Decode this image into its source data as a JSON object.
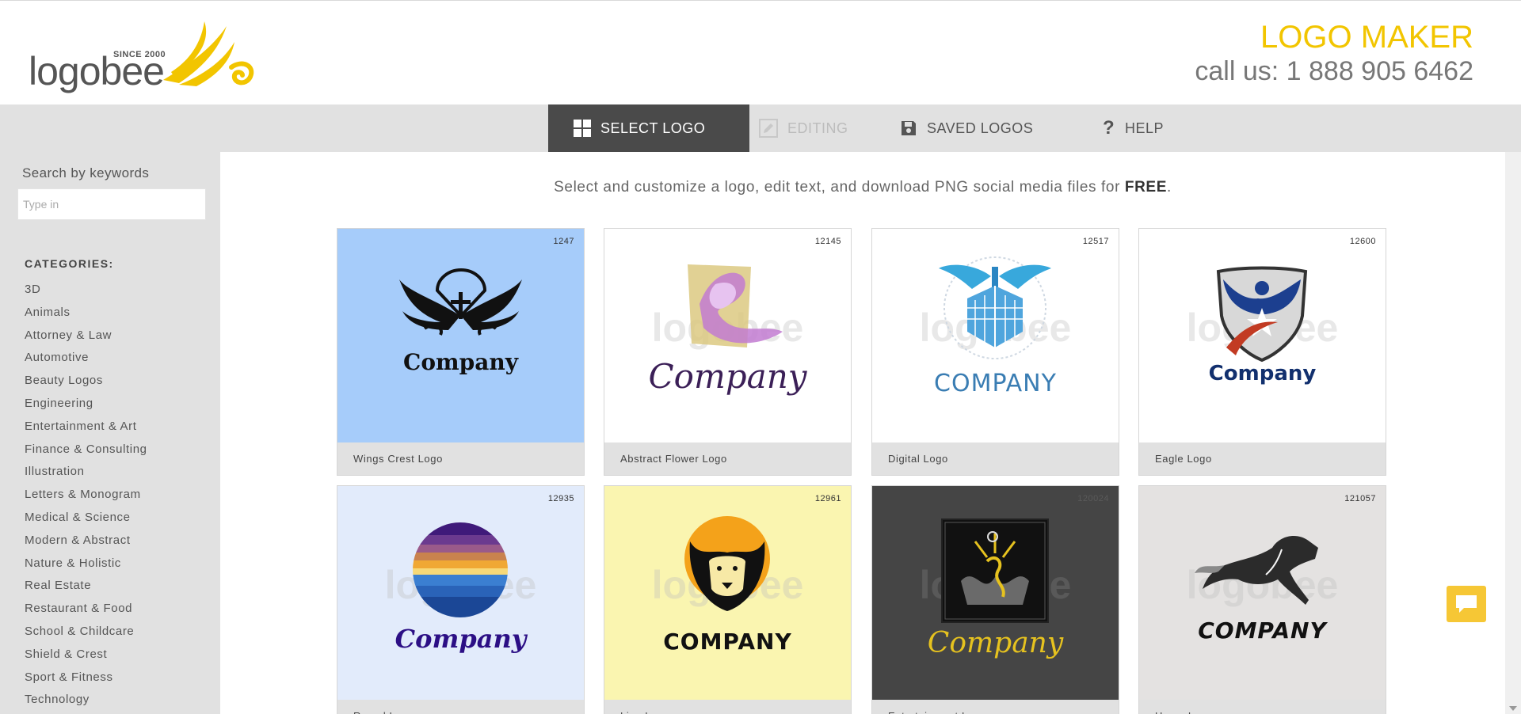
{
  "header": {
    "logo_word": "logobee",
    "logo_since": "SINCE 2000",
    "brand_title": "LOGO MAKER",
    "brand_phone": "call us: 1 888 905 6462",
    "accent_color": "#f2c500"
  },
  "nav": {
    "items": [
      {
        "label": "SELECT LOGO",
        "icon": "grid-icon",
        "state": "active"
      },
      {
        "label": "EDITING",
        "icon": "edit-icon",
        "state": "disabled"
      },
      {
        "label": "SAVED LOGOS",
        "icon": "save-icon",
        "state": "normal"
      },
      {
        "label": "HELP",
        "icon": "help-icon",
        "state": "normal"
      }
    ]
  },
  "sidebar": {
    "search_label": "Search by keywords",
    "search_placeholder": "Type in",
    "categories_title": "CATEGORIES:",
    "categories": [
      "3D",
      "Animals",
      "Attorney & Law",
      "Automotive",
      "Beauty Logos",
      "Engineering",
      "Entertainment & Art",
      "Finance & Consulting",
      "Illustration",
      "Letters & Monogram",
      "Medical & Science",
      "Modern & Abstract",
      "Nature & Holistic",
      "Real Estate",
      "Restaurant & Food",
      "School & Childcare",
      "Shield & Crest",
      "Sport & Fitness",
      "Technology"
    ]
  },
  "main": {
    "intro_text": "Select and customize a logo, edit text, and download PNG social media files for ",
    "intro_strong": "FREE",
    "intro_end": ".",
    "watermark": "logobee",
    "cards": [
      {
        "id": "1247",
        "title": "Wings Crest Logo",
        "company": "Company",
        "bg": "#a6ccfa",
        "text_color": "#111"
      },
      {
        "id": "12145",
        "title": "Abstract Flower Logo",
        "company": "Company",
        "bg": "#ffffff",
        "text_color": "#3b1f57"
      },
      {
        "id": "12517",
        "title": "Digital Logo",
        "company": "COMPANY",
        "bg": "#ffffff",
        "text_color": "#3a7db3"
      },
      {
        "id": "12600",
        "title": "Eagle Logo",
        "company": "Company",
        "bg": "#ffffff",
        "text_color": "#12306e"
      },
      {
        "id": "12935",
        "title": "Round Logo",
        "company": "Company",
        "bg": "#e2ebfb",
        "text_color": "#2c0f85"
      },
      {
        "id": "12961",
        "title": "Lion Logo",
        "company": "COMPANY",
        "bg": "#faf5b0",
        "text_color": "#111"
      },
      {
        "id": "120024",
        "title": "Entertainment Logo",
        "company": "Company",
        "bg": "#454545",
        "text_color": "#e6c21f"
      },
      {
        "id": "121057",
        "title": "Horse Logo",
        "company": "COMPANY",
        "bg": "#e4e2e1",
        "text_color": "#111"
      }
    ]
  }
}
